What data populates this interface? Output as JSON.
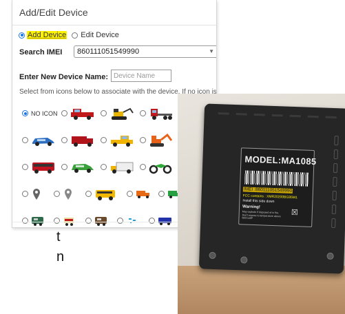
{
  "dialog": {
    "title": "Add/Edit Device",
    "mode_add": "Add Device",
    "mode_edit": "Edit Device",
    "search_imei_label": "Search IMEI",
    "imei_value": "860111051549990",
    "name_label": "Enter New Device Name:",
    "name_placeholder": "Device Name",
    "instructions": "Select from icons below to associate with the device. If no icon is needed,",
    "no_icon_label": "NO ICON"
  },
  "icons": [
    [
      "no-icon",
      "red-pickup",
      "excavator",
      "red-semi-truck",
      "red-tow-truck"
    ],
    [
      "blue-car",
      "red-box-truck",
      "yellow-pickup",
      "orange-excavator",
      "trailer-truck"
    ],
    [
      "red-bus",
      "green-car",
      "white-box-truck",
      "green-motorcycle",
      "orange-motorcycle"
    ],
    [
      "map-pin",
      "gray-pin",
      "school-bus",
      "orange-truck",
      "green-truck",
      "olive-truck"
    ],
    [
      "green-camper",
      "small-red-van",
      "brown-camper",
      "blue-small-truck",
      "blue-van",
      "green-van"
    ]
  ],
  "colors": {
    "accent": "#1a73e8",
    "highlight": "#fff200"
  },
  "side_text": {
    "line1": "t",
    "line2": "n"
  },
  "photo_label": {
    "model": "MODEL:MA1085",
    "imei": "IMEI :860111051549990",
    "fcc": "FCC contains : XMR20200BG95M1",
    "install": "Install this side down",
    "warning": "Warning!",
    "fine_print": "May explode if disposed of in fire. Don't expose to temperature above 60C/140F",
    "bin_icon": "crossed-bin-icon"
  }
}
